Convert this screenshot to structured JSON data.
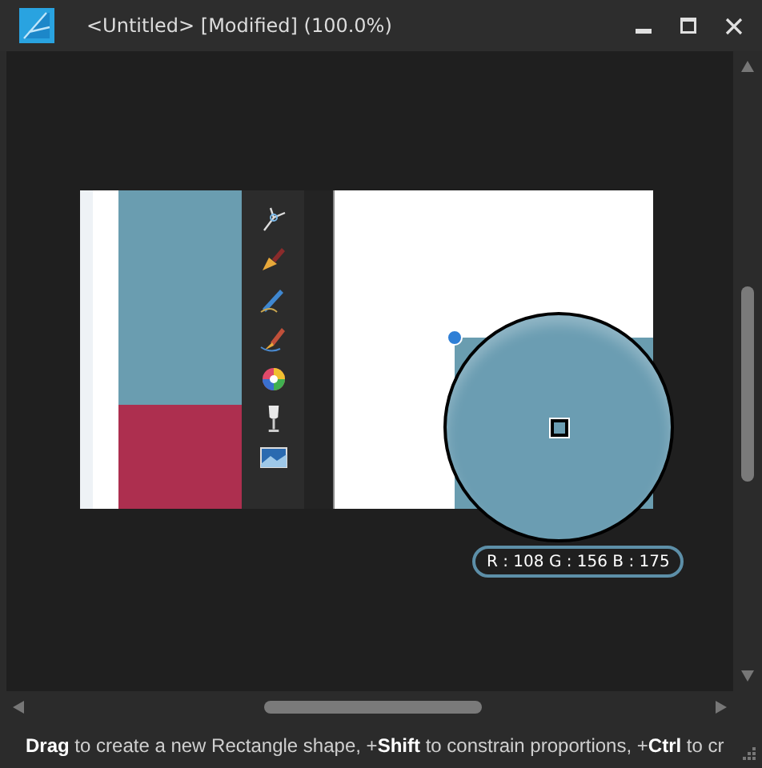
{
  "window": {
    "title": "<Untitled> [Modified] (100.0%)"
  },
  "color_readout": "R : 108 G : 156 B : 175",
  "status_bar": {
    "hint": "**Drag** to create a new Rectangle shape, +**Shift** to constrain proportions, +**Ctrl** to cr"
  }
}
